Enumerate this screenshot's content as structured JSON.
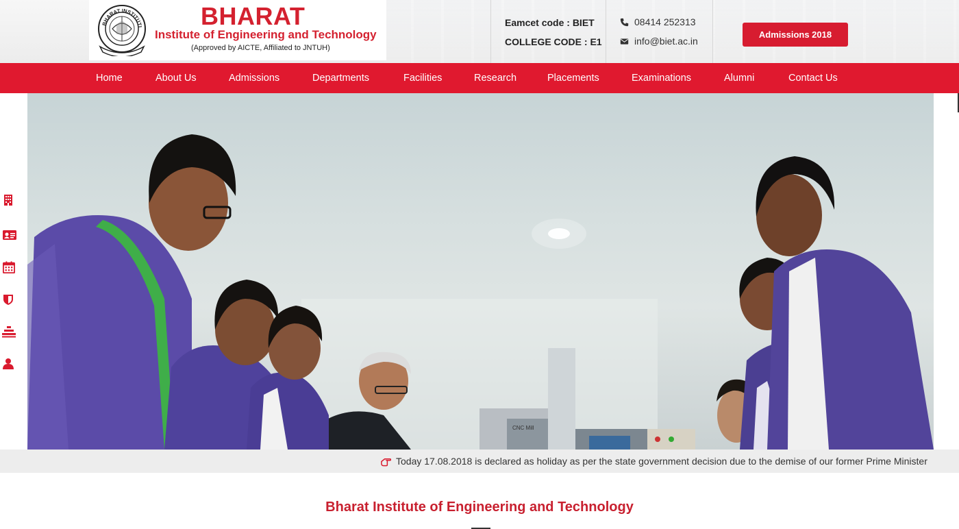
{
  "header": {
    "brand_title": "BHARAT",
    "brand_subtitle": "Institute of Engineering and Technology",
    "brand_approval": "(Approved by AICTE, Affiliated to JNTUH)",
    "seal_text": "BHARAT INSTITUTIONS",
    "eamcet_code": "Eamcet code : BIET",
    "college_code": "COLLEGE CODE : E1",
    "phone": "08414 252313",
    "email": "info@biet.ac.in",
    "admissions_button": "Admissions 2018"
  },
  "nav": {
    "items": [
      {
        "label": "Home"
      },
      {
        "label": "About Us"
      },
      {
        "label": "Admissions"
      },
      {
        "label": "Departments"
      },
      {
        "label": "Facilities"
      },
      {
        "label": "Research"
      },
      {
        "label": "Placements"
      },
      {
        "label": "Examinations"
      },
      {
        "label": "Alumni"
      },
      {
        "label": "Contact Us"
      }
    ]
  },
  "side_icons": [
    "building-icon",
    "id-card-icon",
    "calendar-icon",
    "shield-icon",
    "stack-icon",
    "user-icon"
  ],
  "hero": {
    "machine_label": "CNC Mill"
  },
  "ticker": {
    "text": "Today 17.08.2018 is declared as holiday as per the state government decision due to the demise of our former Prime Minister"
  },
  "section": {
    "title": "Bharat Institute of Engineering and Technology"
  },
  "colors": {
    "brand_red": "#e0192f",
    "title_red": "#c8202f",
    "button_red": "#d71c30"
  }
}
